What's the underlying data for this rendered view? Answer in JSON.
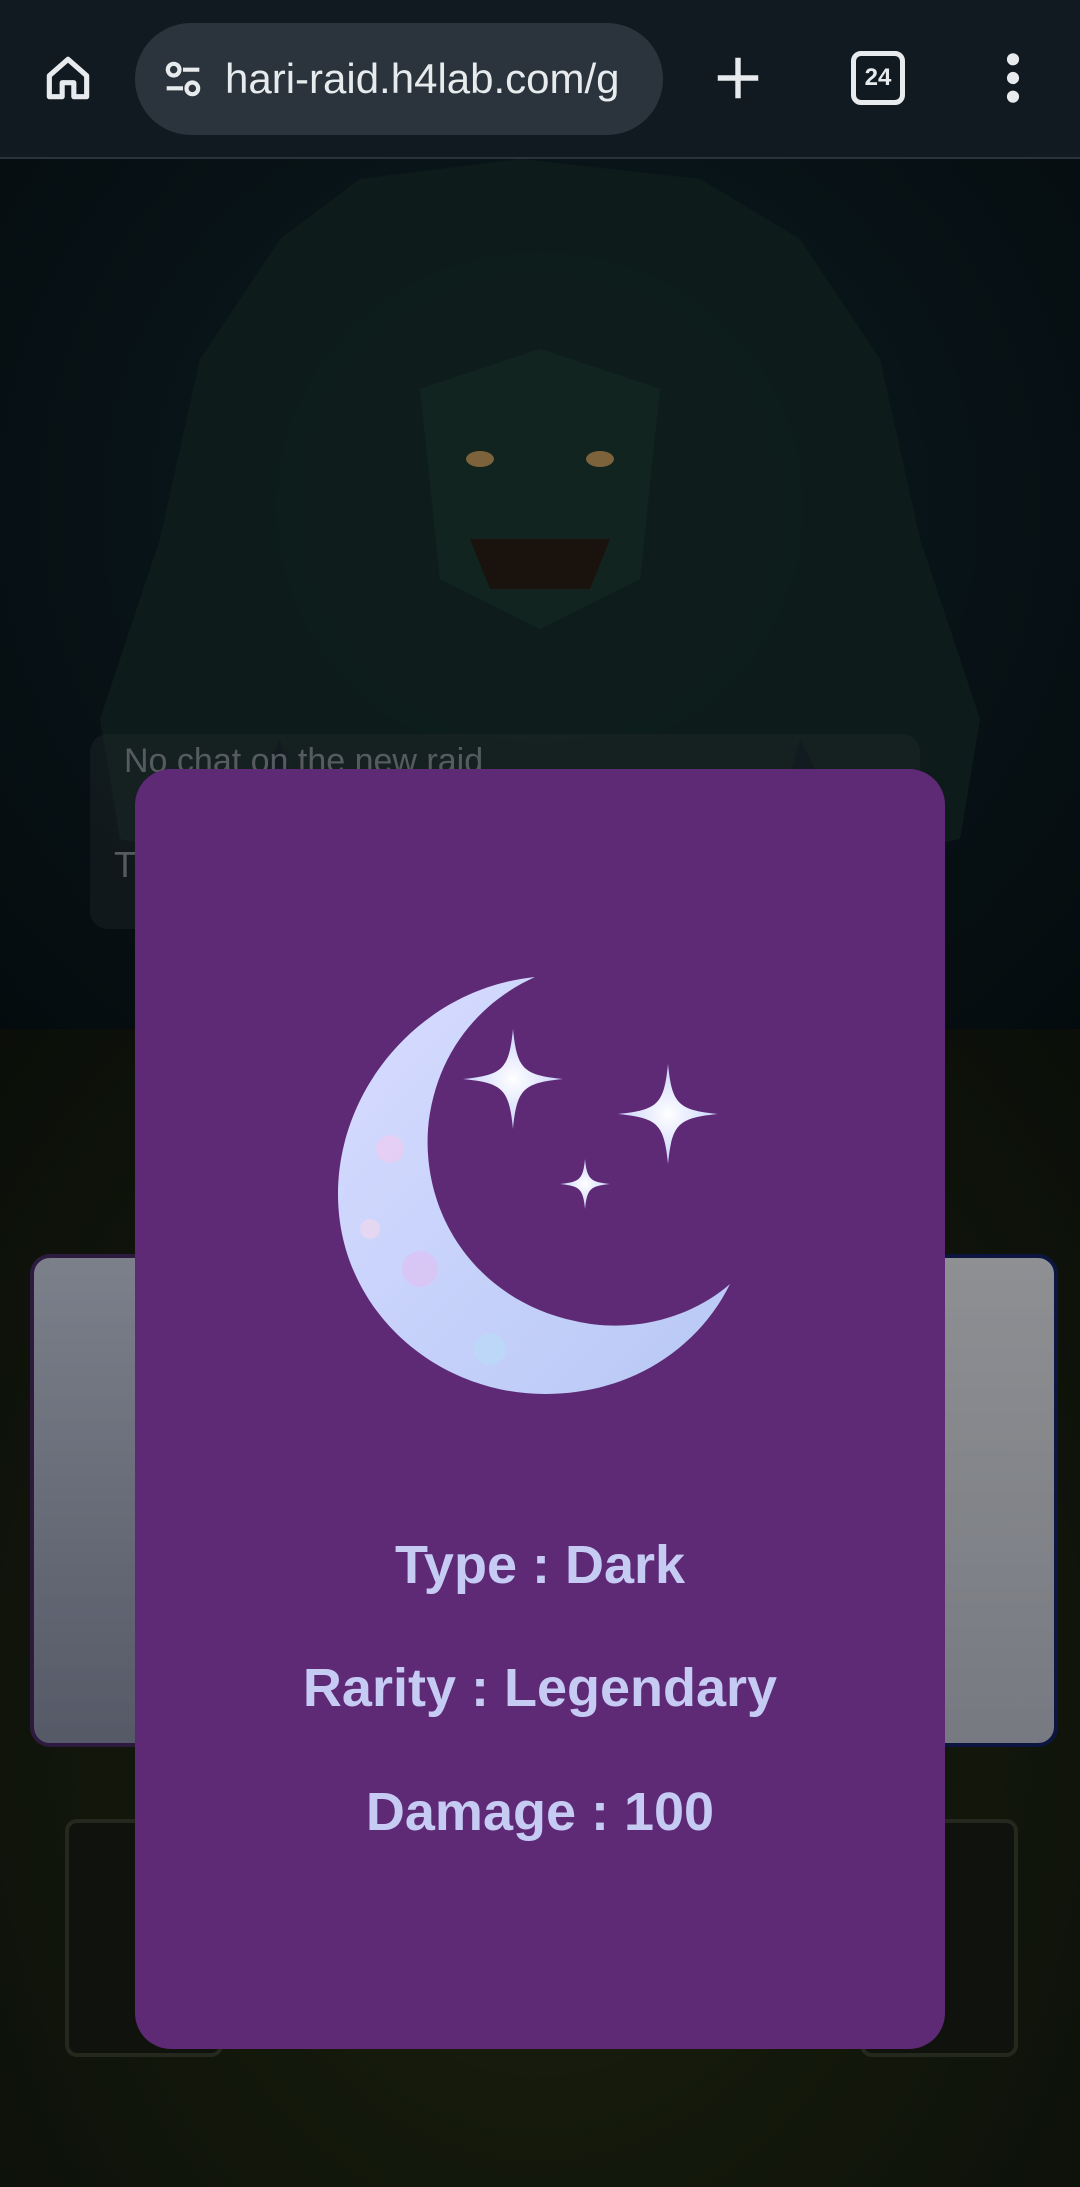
{
  "browser": {
    "url": "hari-raid.h4lab.com/g",
    "tab_count": "24",
    "icons": [
      "home-icon",
      "site-settings-icon",
      "plus-icon",
      "tabs-icon",
      "more-vert-icon"
    ]
  },
  "background": {
    "chat_placeholder": "No chat on the new raid",
    "chat_input": "T"
  },
  "card": {
    "type_line": "Type : Dark",
    "rarity_line": "Rarity : Legendary",
    "damage_line": "Damage : 100",
    "icon": "moon-stars-icon",
    "background_color": "#5e2a76",
    "text_color": "#c6cbf4"
  }
}
